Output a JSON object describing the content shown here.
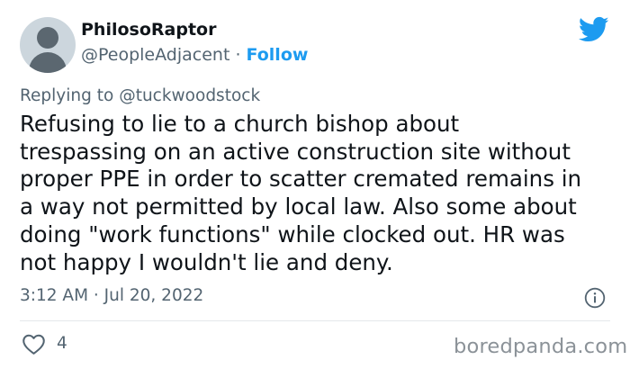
{
  "author": {
    "display_name": "PhilosoRaptor",
    "handle": "@PeopleAdjacent",
    "separator": " · ",
    "follow_label": "Follow"
  },
  "reply": {
    "prefix": "Replying to ",
    "mention": "@tuckwoodstock"
  },
  "tweet": {
    "lines": [
      "Refusing to lie to a church bishop about",
      "trespassing on an active construction site without",
      "proper PPE in order to scatter cremated remains in",
      "a way not permitted by local law. Also some about",
      "doing \"work functions\" while clocked out. HR was",
      "not happy I wouldn't lie and deny."
    ]
  },
  "meta": {
    "timestamp": "3:12 AM · Jul 20, 2022"
  },
  "actions": {
    "like_count": "4"
  },
  "watermark": "boredpanda.com",
  "icons": {
    "logo": "twitter-bird-icon",
    "info": "info-icon",
    "like": "heart-icon"
  },
  "colors": {
    "brand_blue": "#1d9bf0",
    "text_primary": "#0f1419",
    "text_secondary": "#536471",
    "avatar_bg": "#ccd6dd",
    "avatar_fg": "#5b6770"
  }
}
